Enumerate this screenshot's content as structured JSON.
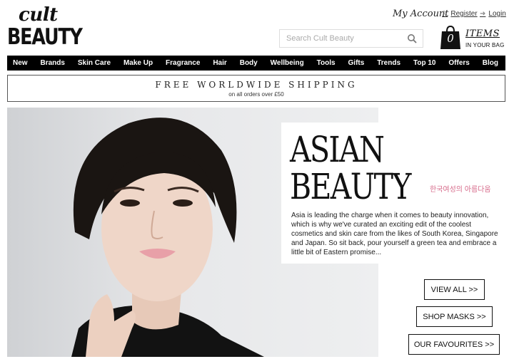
{
  "header": {
    "logo_top": "cult",
    "logo_bottom": "BEAUTY",
    "account_label": "My Account",
    "register_label": "Register",
    "login_label": "Login",
    "search_placeholder": "Search Cult Beauty",
    "bag_count": "0",
    "bag_title": "ITEMS",
    "bag_subtitle": "IN YOUR BAG"
  },
  "nav": {
    "items": [
      "New",
      "Brands",
      "Skin Care",
      "Make Up",
      "Fragrance",
      "Hair",
      "Body",
      "Wellbeing",
      "Tools",
      "Gifts",
      "Trends",
      "Top 10",
      "Offers",
      "Blog"
    ]
  },
  "shipping": {
    "headline": "FREE WORLDWIDE SHIPPING",
    "subline": "on all orders over £50"
  },
  "feature": {
    "title_line1": "ASIAN",
    "title_line2": "BEAUTY",
    "korean": "한국여성의 아름다움",
    "description": "Asia is leading the charge when it comes to beauty innovation, which is why we've curated an exciting edit of the coolest cosmetics and skin care from the likes of South Korea, Singapore and Japan. So sit back, pour yourself a green tea and embrace a little bit of Eastern promise..."
  },
  "buttons": {
    "view_all": "VIEW ALL  >>",
    "shop_masks": "SHOP MASKS  >>",
    "our_favourites": "OUR FAVOURITES  >>"
  },
  "colors": {
    "nav_bg": "#000000",
    "accent_pink": "#d66a8a"
  },
  "icons": {
    "search": "search-icon",
    "bag": "shopping-bag-icon",
    "register": "pencil-icon",
    "login": "login-arrow-icon"
  }
}
